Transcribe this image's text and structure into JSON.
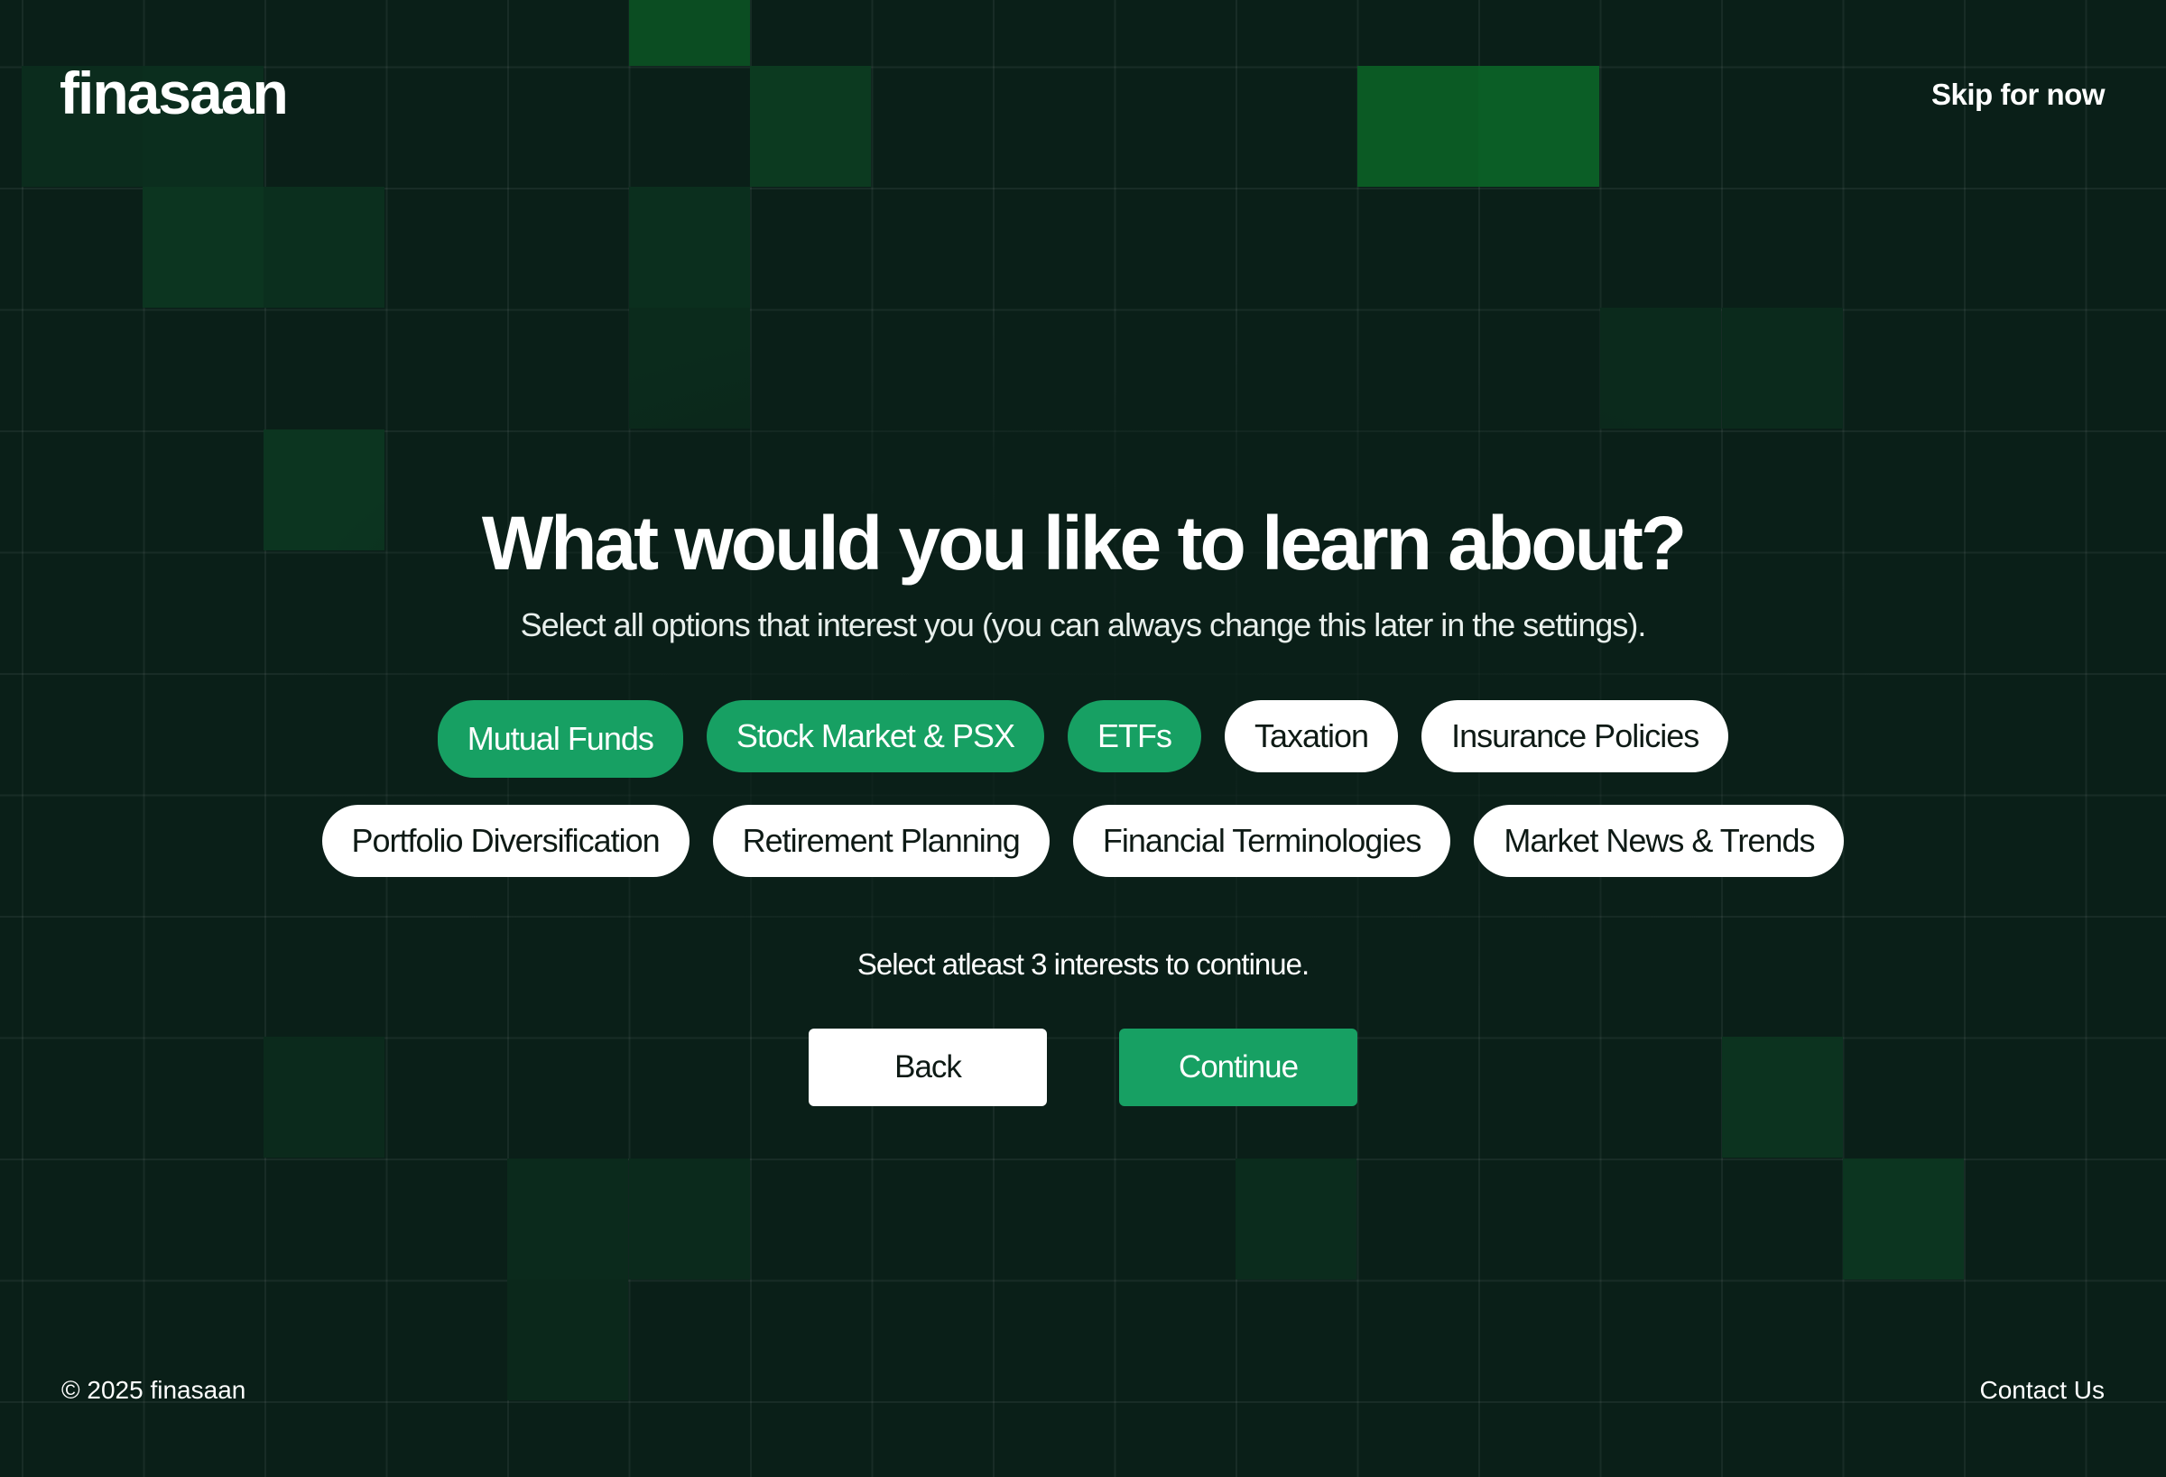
{
  "header": {
    "logo_text": "finasaan",
    "skip_label": "Skip for now"
  },
  "main": {
    "heading": "What would you like to learn about?",
    "subtitle": "Select all options that interest you (you can always change this later in the settings).",
    "interests_row1": [
      {
        "label": "Mutual Funds",
        "selected": true
      },
      {
        "label": "Stock Market & PSX",
        "selected": true
      },
      {
        "label": "ETFs",
        "selected": true
      },
      {
        "label": "Taxation",
        "selected": false
      },
      {
        "label": "Insurance Policies",
        "selected": false
      }
    ],
    "interests_row2": [
      {
        "label": "Portfolio Diversification",
        "selected": false
      },
      {
        "label": "Retirement Planning",
        "selected": false
      },
      {
        "label": "Financial Terminologies",
        "selected": false
      },
      {
        "label": "Market News & Trends",
        "selected": false
      }
    ],
    "hint": "Select atleast 3 interests to continue.",
    "back_label": "Back",
    "continue_label": "Continue"
  },
  "footer": {
    "copyright": "© 2025 finasaan",
    "contact_label": "Contact Us"
  },
  "colors": {
    "background": "#0a1f18",
    "accent": "#17a063",
    "highlight_tile": "#0b5e26"
  }
}
